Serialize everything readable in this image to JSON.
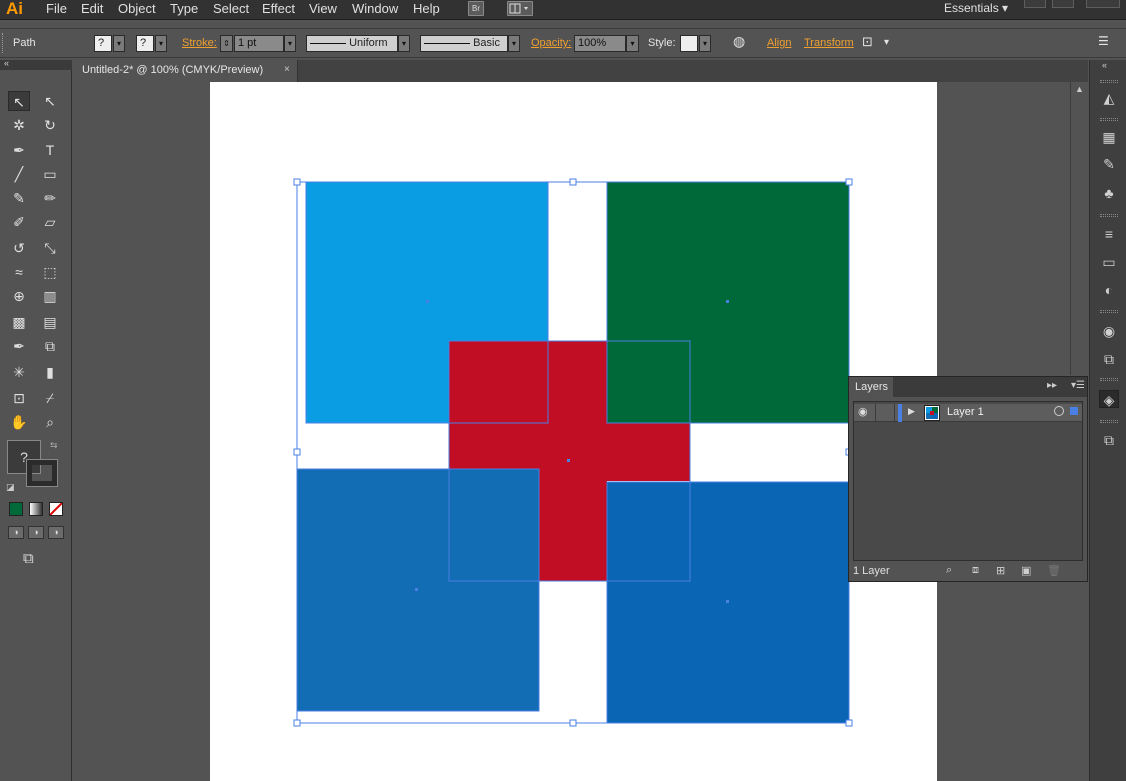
{
  "app": {
    "logo": "Ai"
  },
  "menu": {
    "items": [
      "File",
      "Edit",
      "Object",
      "Type",
      "Select",
      "Effect",
      "View",
      "Window",
      "Help"
    ],
    "bridge_label": "Br",
    "workspace": "Essentials"
  },
  "control_bar": {
    "selection_type": "Path",
    "fill_value": "?",
    "stroke_swatch_value": "?",
    "stroke_label": "Stroke:",
    "stroke_weight": "1 pt",
    "stroke_profile": "Uniform",
    "brush": "Basic",
    "opacity_label": "Opacity:",
    "opacity_value": "100%",
    "style_label": "Style:",
    "align_label": "Align",
    "transform_label": "Transform"
  },
  "document": {
    "tab_title": "Untitled-2* @ 100% (CMYK/Preview)",
    "close_glyph": "×"
  },
  "tools": {
    "unknown_fill_label": "?",
    "icons": [
      "selection-tool-icon",
      "direct-selection-tool-icon",
      "magic-wand-tool-icon",
      "lasso-tool-icon",
      "pen-tool-icon",
      "type-tool-icon",
      "line-segment-tool-icon",
      "rectangle-tool-icon",
      "paintbrush-tool-icon",
      "pencil-tool-icon",
      "blob-brush-tool-icon",
      "eraser-tool-icon",
      "rotate-tool-icon",
      "scale-tool-icon",
      "warp-tool-icon",
      "free-transform-tool-icon",
      "shape-builder-tool-icon",
      "perspective-grid-tool-icon",
      "mesh-tool-icon",
      "gradient-tool-icon",
      "eyedropper-tool-icon",
      "blend-tool-icon",
      "symbol-sprayer-tool-icon",
      "column-graph-tool-icon",
      "artboard-tool-icon",
      "slice-tool-icon",
      "hand-tool-icon",
      "zoom-tool-icon"
    ]
  },
  "artwork": {
    "colors": {
      "cyan_square": "#0a9de3",
      "green_square": "#00693a",
      "red_cross": "#c20e25",
      "blue_square_left": "#136db4",
      "blue_square_right": "#0a66b4",
      "selection": "#4a7fe3"
    }
  },
  "layers_panel": {
    "tab_label": "Layers",
    "layers": [
      {
        "name": "Layer 1"
      }
    ],
    "count_label": "1 Layer"
  }
}
